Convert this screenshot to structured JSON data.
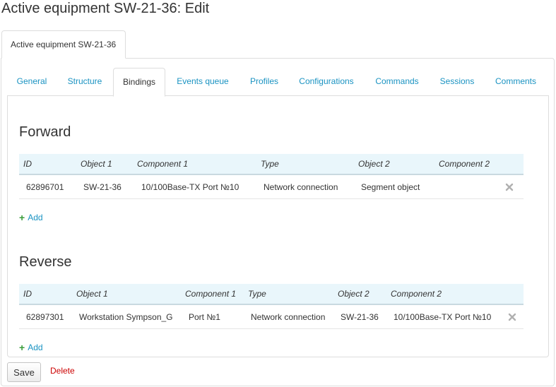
{
  "page": {
    "title": "Active equipment SW-21-36: Edit"
  },
  "outer_tab": {
    "label": "Active equipment SW-21-36"
  },
  "tabs": [
    {
      "label": "General"
    },
    {
      "label": "Structure"
    },
    {
      "label": "Bindings"
    },
    {
      "label": "Events queue"
    },
    {
      "label": "Profiles"
    },
    {
      "label": "Configurations"
    },
    {
      "label": "Commands"
    },
    {
      "label": "Sessions"
    },
    {
      "label": "Comments"
    }
  ],
  "active_tab": "Bindings",
  "forward": {
    "title": "Forward",
    "columns": [
      "ID",
      "Object 1",
      "Component 1",
      "Type",
      "Object 2",
      "Component 2"
    ],
    "rows": [
      [
        "62896701",
        "SW-21-36",
        "10/100Base-TX Port №10",
        "Network connection",
        "Segment object",
        ""
      ]
    ],
    "add_label": "Add"
  },
  "reverse": {
    "title": "Reverse",
    "columns": [
      "ID",
      "Object 1",
      "Component 1",
      "Type",
      "Object 2",
      "Component 2"
    ],
    "rows": [
      [
        "62897301",
        "Workstation Sympson_G",
        "Port №1",
        "Network connection",
        "SW-21-36",
        "10/100Base-TX Port №10"
      ]
    ],
    "add_label": "Add"
  },
  "actions": {
    "save_label": "Save",
    "delete_label": "Delete"
  },
  "colors": {
    "link": "#1a93c2",
    "delete": "#cc0000",
    "add_plus": "#3a9d3a",
    "grid_header_bg": "#e9f6fb"
  },
  "icons": {
    "remove": "close-x-icon",
    "add": "plus-icon"
  }
}
